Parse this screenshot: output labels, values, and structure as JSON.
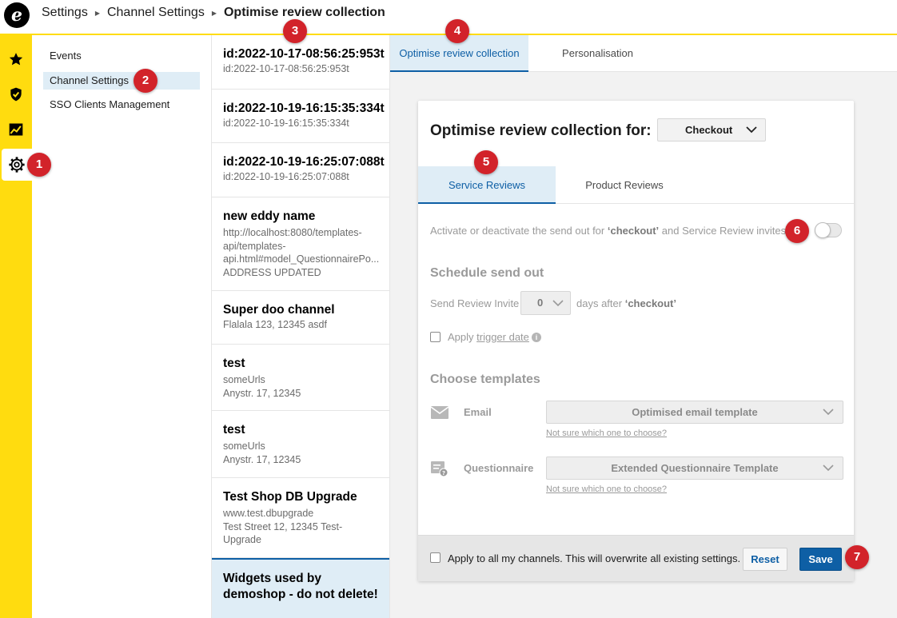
{
  "breadcrumb": {
    "items": [
      "Settings",
      "Channel Settings"
    ],
    "current": "Optimise review collection"
  },
  "rail": {
    "icons": [
      "star-icon",
      "shield-check-icon",
      "chart-icon",
      "gear-icon"
    ]
  },
  "submenu": {
    "items": [
      {
        "label": "Events"
      },
      {
        "label": "Channel Settings"
      },
      {
        "label": "SSO Clients Management"
      }
    ]
  },
  "channels": [
    {
      "name": "id:2022-10-17-08:56:25:953t",
      "lines": [
        "id:2022-10-17-08:56:25:953t"
      ]
    },
    {
      "name": "id:2022-10-19-16:15:35:334t",
      "lines": [
        "id:2022-10-19-16:15:35:334t"
      ]
    },
    {
      "name": "id:2022-10-19-16:25:07:088t",
      "lines": [
        "id:2022-10-19-16:25:07:088t"
      ]
    },
    {
      "name": "new eddy name",
      "lines": [
        "http://localhost:8080/templates-",
        "api/templates-",
        "api.html#model_QuestionnairePo...",
        "ADDRESS UPDATED"
      ]
    },
    {
      "name": "Super doo channel",
      "lines": [
        "Flalala 123, 12345 asdf"
      ]
    },
    {
      "name": "test",
      "lines": [
        "someUrls",
        "Anystr. 17, 12345"
      ]
    },
    {
      "name": "test",
      "lines": [
        "someUrls",
        "Anystr. 17, 12345"
      ]
    },
    {
      "name": "Test Shop DB Upgrade",
      "lines": [
        "www.test.dbupgrade",
        "Test Street 12, 12345 Test-",
        "Upgrade"
      ]
    },
    {
      "name": "Widgets used by demoshop - do not delete!",
      "lines": []
    }
  ],
  "main_tabs": [
    {
      "label": "Optimise review collection"
    },
    {
      "label": "Personalisation"
    }
  ],
  "card": {
    "title": "Optimise review collection for:",
    "context_value": "Checkout",
    "sub_tabs": [
      {
        "label": "Service Reviews"
      },
      {
        "label": "Product Reviews"
      }
    ],
    "activate_text_pre": "Activate or deactivate the send out for ",
    "activate_text_bold": "‘checkout’",
    "activate_text_post": " and Service Review invites.",
    "toggle_on": false,
    "schedule_heading": "Schedule send out",
    "send_label": "Send Review Invite",
    "days_value": "0",
    "days_after_pre": "days after ",
    "days_after_bold": "‘checkout’",
    "apply_prefix": "Apply ",
    "trigger_link": "trigger date",
    "templates_heading": "Choose templates",
    "email_label": "Email",
    "email_template": "Optimised email template",
    "questionnaire_label": "Questionnaire",
    "questionnaire_template": "Extended Questionnaire Template",
    "help_link": "Not sure which one to choose?",
    "apply_all": "Apply to all my channels. This will overwrite all existing settings.",
    "reset_label": "Reset",
    "save_label": "Save"
  },
  "markers": [
    "1",
    "2",
    "3",
    "4",
    "5",
    "6",
    "7"
  ],
  "colors": {
    "brand_yellow": "#ffdc0f",
    "accent_blue": "#0e5fa5",
    "active_bg": "#dfedf6",
    "marker_red": "#d2232a"
  }
}
